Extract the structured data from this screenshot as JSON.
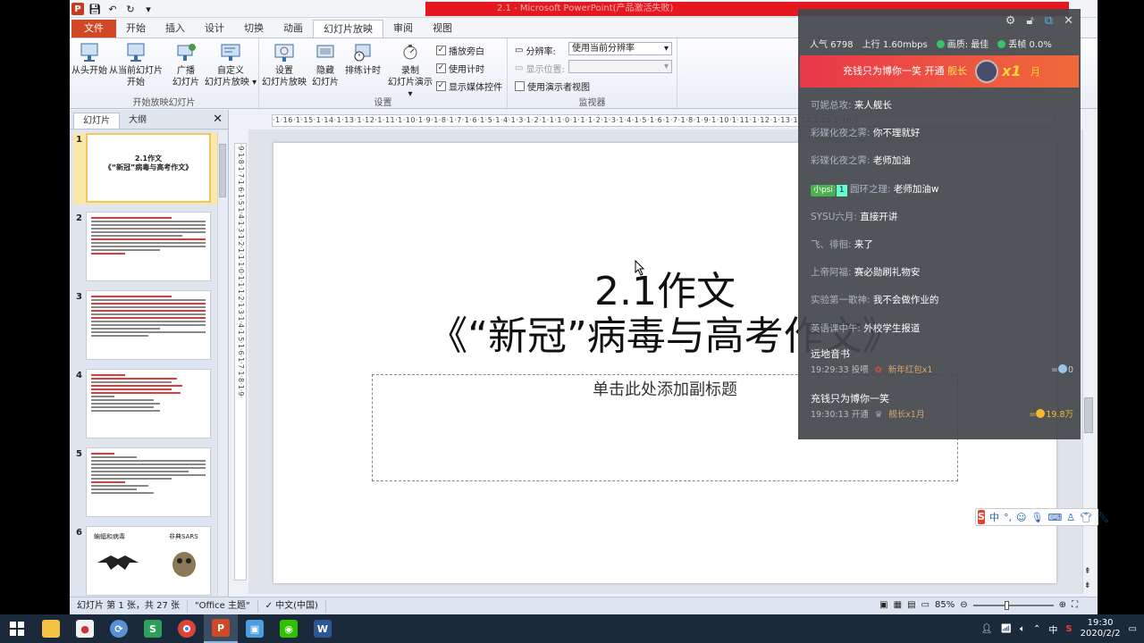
{
  "window": {
    "title": "2.1 - Microsoft PowerPoint(产品激活失败)"
  },
  "ribbon": {
    "tabs": [
      "文件",
      "开始",
      "插入",
      "设计",
      "切换",
      "动画",
      "幻灯片放映",
      "审阅",
      "视图"
    ],
    "active_tab": "幻灯片放映",
    "start_group": {
      "label": "开始放映幻灯片",
      "from_start": "从头开始",
      "from_current_l1": "从当前幻灯片",
      "from_current_l2": "开始",
      "broadcast_l1": "广播",
      "broadcast_l2": "幻灯片",
      "custom_l1": "自定义",
      "custom_l2": "幻灯片放映"
    },
    "setup_group": {
      "label": "设置",
      "setup_l1": "设置",
      "setup_l2": "幻灯片放映",
      "hide_l1": "隐藏",
      "hide_l2": "幻灯片",
      "rehearse": "排练计时",
      "record_l1": "录制",
      "record_l2": "幻灯片演示",
      "play_narrations": "播放旁白",
      "use_timings": "使用计时",
      "show_media_controls": "显示媒体控件"
    },
    "monitor_group": {
      "label": "监视器",
      "resolution_label": "分辨率:",
      "resolution_value": "使用当前分辨率",
      "show_on_label": "显示位置:",
      "presenter_view": "使用演示者视图"
    }
  },
  "panel": {
    "tabs": [
      "幻灯片",
      "大纲"
    ],
    "thumbnails": [
      {
        "num": "1",
        "line1": "2.1作文",
        "line2": "《“新冠”病毒与高考作文》"
      },
      {
        "num": "2"
      },
      {
        "num": "3"
      },
      {
        "num": "4"
      },
      {
        "num": "5"
      },
      {
        "num": "6",
        "left_caption": "蝙蝠和病毒",
        "right_caption": "非典SARS"
      }
    ]
  },
  "rulers": {
    "horizontal": "·1·16·1·15·1·14·1·13·1·12·1·11·1·10·1·9·1·8·1·7·1·6·1·5·1·4·1·3·1·2·1·1·1·0·1·1·1·2·1·3·1·4·1·5·1·6·1·7·1·8·1·9·1·10·1·11·1·12·1·13·1·14·1·15·1·16·1",
    "vertical": "·9·1·8·1·7·1·6·1·5·1·4·1·3·1·2·1·1·1·0·1·1·1·2·1·3·1·4·1·5·1·6·1·7·1·8·1·9·"
  },
  "slide": {
    "title_line1": "2.1作文",
    "title_line2": "《“新冠”病毒与高考作文》",
    "subtitle_placeholder": "单击此处添加副标题"
  },
  "status": {
    "slide_info": "幻灯片 第 1 张，共 27 张",
    "theme": "\"Office 主题\"",
    "language": "中文(中国)",
    "zoom": "85%",
    "zoom_level_fraction": 0.42
  },
  "overlay": {
    "popularity_label": "人气",
    "popularity_value": "6798",
    "upload_label": "上行",
    "upload_value": "1.60mbps",
    "quality_label": "画质: 最佳",
    "drop_label": "丢帧 0.0%",
    "banner_text": "充钱只为博你一笑 开通",
    "banner_highlight": "舰长",
    "banner_count": "x1",
    "banner_unit": "月",
    "messages": [
      {
        "user": "可妮总攻:",
        "text": "来人舰长"
      },
      {
        "user": "彩碟化夜之霁:",
        "text": "你不理就好"
      },
      {
        "user": "彩碟化夜之霁:",
        "text": "老师加油"
      },
      {
        "badge": "小psi",
        "level": "1",
        "user": "圆环之理:",
        "text": "老师加油w"
      },
      {
        "user": "SYSU六月:",
        "text": "直接开讲"
      },
      {
        "user": "飞、徘徊:",
        "text": "来了"
      },
      {
        "user": "上帝阿福:",
        "text": "赛必勋刷礼物安"
      },
      {
        "user": "实验第一歌神:",
        "text": "我不会做作业的"
      },
      {
        "user": "英语课中午:",
        "text": "外校学生报道"
      }
    ],
    "gifts": [
      {
        "name": "远地音书",
        "time": "19:29:33",
        "action": "投喂",
        "gift": "新年红包x1",
        "amount": "0"
      },
      {
        "name": "充钱只为博你一笑",
        "time": "19:30:13",
        "action": "开通",
        "gift": "舰长x1月",
        "amount": "19.8万"
      }
    ],
    "colors": {
      "accent": "#e8384a",
      "gold": "#f5b92e",
      "green": "#3cc26a"
    }
  },
  "ime": {
    "logo": "S",
    "mode": "中"
  },
  "taskbar": {
    "clock_time": "19:30",
    "clock_date": "2020/2/2",
    "ime_indicator": "中",
    "apps": [
      "start-icon",
      "file-explorer-icon",
      "media-icon",
      "browser-icon",
      "spotify-icon",
      "chrome-icon",
      "powerpoint-icon",
      "photo-icon",
      "wechat-icon",
      "word-icon"
    ]
  }
}
